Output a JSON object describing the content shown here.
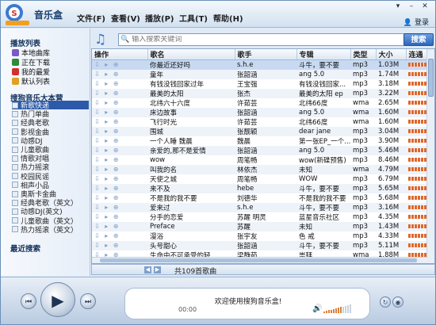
{
  "app": {
    "title": "音乐盒",
    "login": "登录"
  },
  "menu": [
    "文件(F)",
    "查看(V)",
    "播放(P)",
    "工具(T)",
    "帮助(H)"
  ],
  "sidebar": {
    "playlist_header": "播放列表",
    "playlists": [
      {
        "label": "本地曲库",
        "icon": "music-note-icon",
        "color": "#7a5ac8"
      },
      {
        "label": "正在下载",
        "icon": "download-icon",
        "color": "#2f8a3a"
      },
      {
        "label": "我的最爱",
        "icon": "heart-icon",
        "color": "#d03030"
      },
      {
        "label": "默认列表",
        "icon": "folder-icon",
        "color": "#e0a020"
      }
    ],
    "catalog_header": "搜狗音乐大本营",
    "categories": [
      "新歌快递",
      "热门单曲",
      "经典老歌",
      "影视金曲",
      "动感DJ",
      "儿童歌曲",
      "情歌对唱",
      "热力摇滚",
      "校园民谣",
      "相声小品",
      "奥斯卡金曲",
      "经典老歌（英文）",
      "动感DJ(英文)",
      "儿童歌曲（英文）",
      "热力摇滚（英文）"
    ],
    "selected_category": 0,
    "recent_header": "最近搜索"
  },
  "search": {
    "placeholder": "输入搜索关键词",
    "button": "搜索"
  },
  "table": {
    "columns": [
      "操作",
      "歌名",
      "歌手",
      "专辑",
      "类型",
      "大小",
      "连通"
    ],
    "rows": [
      [
        "你最近还好吗",
        "s.h.e",
        "斗牛，要不要",
        "mp3",
        "1.03M"
      ],
      [
        "童年",
        "张韶涵",
        "ang 5.0",
        "mp3",
        "1.74M"
      ],
      [
        "有钱没钱回家过年",
        "王宝强",
        "有钱没钱回家...",
        "mp3",
        "3.18M"
      ],
      [
        "最美的太阳",
        "张杰",
        "最美的太阳 ep",
        "mp3",
        "3.22M"
      ],
      [
        "北纬六十六度",
        "许茹芸",
        "北纬66度",
        "wma",
        "2.65M"
      ],
      [
        "床边故事",
        "张韶涵",
        "ang 5.0",
        "wma",
        "1.60M"
      ],
      [
        "飞行时光",
        "许茹芸",
        "北纬66度",
        "wma",
        "1.60M"
      ],
      [
        "围城",
        "张靓颖",
        "dear jane",
        "mp3",
        "3.04M"
      ],
      [
        "一个人睡 魏晨",
        "魏晨",
        "第一张EP_一个...",
        "mp3",
        "3.90M"
      ],
      [
        "亲爱的,那不是爱情",
        "张韶涵",
        "ang 5.0",
        "mp3",
        "5.46M"
      ],
      [
        "wow",
        "周笔畅",
        "wow(新碟预售)",
        "mp3",
        "8.46M"
      ],
      [
        "叫我的名",
        "林依杰",
        "未知",
        "wma",
        "4.79M"
      ],
      [
        "天使之城",
        "周笔畅",
        "WOW",
        "mp3",
        "6.79M"
      ],
      [
        "来不及",
        "hebe",
        "斗牛，要不要",
        "mp3",
        "5.65M"
      ],
      [
        "不是我的我不要",
        "刘德华",
        "不是我的我不要",
        "mp3",
        "5.68M"
      ],
      [
        "爱来过",
        "s.h.e",
        "斗牛，要不要",
        "mp3",
        "3.16M"
      ],
      [
        "分手的恋爱",
        "苏醒 明灵",
        "蓝星音乐社区",
        "mp3",
        "4.35M"
      ],
      [
        "Preface",
        "苏醒",
        "未知",
        "mp3",
        "1.43M"
      ],
      [
        "漫浴",
        "张宇友",
        "色 戒",
        "mp3",
        "4.33M"
      ],
      [
        "头号甜心",
        "张韶涵",
        "斗牛，要不要",
        "mp3",
        "5.11M"
      ],
      [
        "生命中不可承受的轻",
        "梁静茹",
        "崇拜",
        "wma",
        "1.88M"
      ]
    ],
    "footer": "共109首歌曲"
  },
  "player": {
    "now_playing": "欢迎使用搜狗音乐盒!",
    "time": "00:00",
    "volume": 0.7
  },
  "colors": {
    "accent": "#2d5aa8",
    "bar": "#e0672b"
  }
}
